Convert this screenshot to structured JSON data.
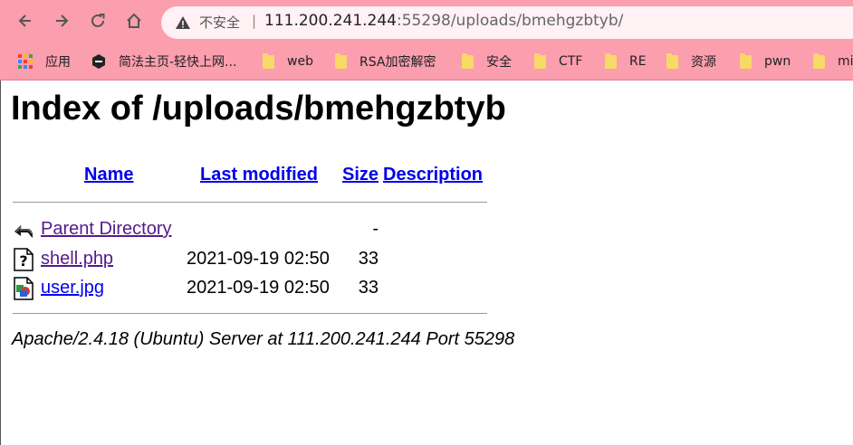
{
  "browser": {
    "security_label": "不安全",
    "separator": "|",
    "url_host": "111.200.241.244",
    "url_rest": ":55298/uploads/bmehgzbtyb/",
    "bookmarks": [
      {
        "label": "应用",
        "icon": "apps-grid-icon"
      },
      {
        "label": "简法主页-轻快上网...",
        "icon": "site-hex-icon"
      },
      {
        "label": "web",
        "icon": "folder-icon"
      },
      {
        "label": "RSA加密解密",
        "icon": "folder-icon"
      },
      {
        "label": "安全",
        "icon": "folder-icon"
      },
      {
        "label": "CTF",
        "icon": "folder-icon"
      },
      {
        "label": "RE",
        "icon": "folder-icon"
      },
      {
        "label": "资源",
        "icon": "folder-icon"
      },
      {
        "label": "pwn",
        "icon": "folder-icon"
      },
      {
        "label": "mi",
        "icon": "folder-icon"
      }
    ]
  },
  "page": {
    "title": "Index of /uploads/bmehgzbtyb",
    "columns": {
      "name": "Name",
      "last_modified": "Last modified",
      "size": "Size",
      "description": "Description"
    },
    "rows": [
      {
        "name": "Parent Directory",
        "date": "",
        "size": "-",
        "icon": "back-arrow-icon"
      },
      {
        "name": "shell.php",
        "date": "2021-09-19 02:50",
        "size": "33",
        "icon": "unknown-file-icon"
      },
      {
        "name": "user.jpg",
        "date": "2021-09-19 02:50",
        "size": "33",
        "icon": "image-file-icon"
      }
    ],
    "footer": "Apache/2.4.18 (Ubuntu) Server at 111.200.241.244 Port 55298"
  }
}
